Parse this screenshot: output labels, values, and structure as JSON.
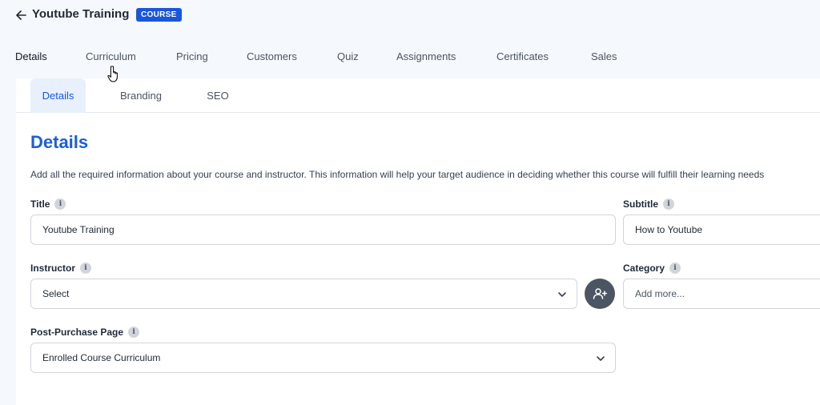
{
  "header": {
    "back_icon": "arrow-left-icon",
    "title": "Youtube Training",
    "badge": "COURSE"
  },
  "main_tabs": [
    {
      "label": "Details",
      "active": true
    },
    {
      "label": "Curriculum",
      "active": false
    },
    {
      "label": "Pricing",
      "active": false
    },
    {
      "label": "Customers",
      "active": false
    },
    {
      "label": "Quiz",
      "active": false
    },
    {
      "label": "Assignments",
      "active": false
    },
    {
      "label": "Certificates",
      "active": false
    },
    {
      "label": "Sales",
      "active": false
    }
  ],
  "sub_tabs": [
    {
      "label": "Details",
      "active": true
    },
    {
      "label": "Branding",
      "active": false
    },
    {
      "label": "SEO",
      "active": false
    }
  ],
  "section": {
    "title": "Details",
    "description": "Add all the required information about your course and instructor. This information will help your target audience in deciding whether this course will fulfill their learning needs"
  },
  "fields": {
    "title": {
      "label": "Title",
      "value": "Youtube Training"
    },
    "subtitle": {
      "label": "Subtitle",
      "value": "How to Youtube"
    },
    "instructor": {
      "label": "Instructor",
      "value": "Select"
    },
    "category": {
      "label": "Category",
      "placeholder": "Add more..."
    },
    "post_purchase": {
      "label": "Post-Purchase Page",
      "value": "Enrolled Course Curriculum"
    }
  },
  "info_glyph": "i",
  "colors": {
    "accent": "#1a56db",
    "heading": "#1a5fd8",
    "active_tab_bg": "#e8f0fc",
    "add_button": "#4b5563"
  }
}
